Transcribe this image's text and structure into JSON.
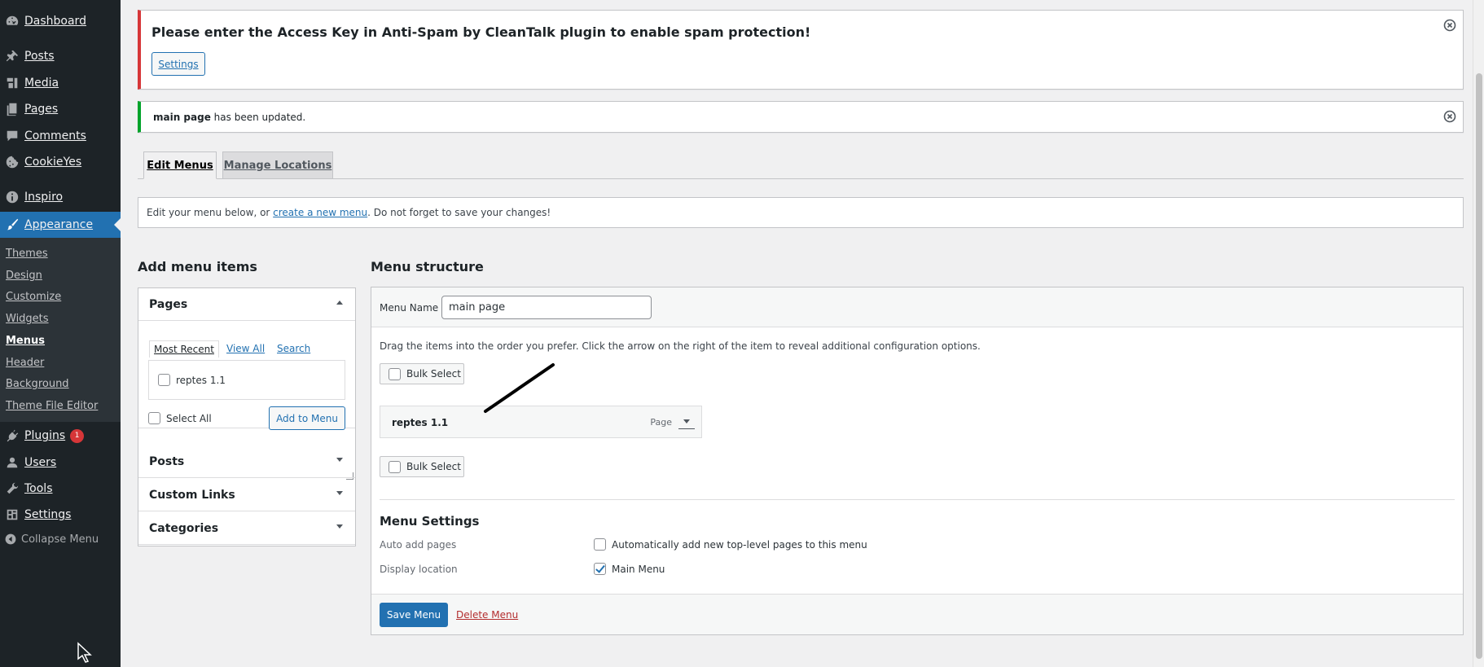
{
  "sidebar": {
    "items": [
      {
        "label": "Dashboard",
        "icon": "dashboard-icon"
      },
      {
        "label": "Posts",
        "icon": "pin-icon"
      },
      {
        "label": "Media",
        "icon": "media-icon"
      },
      {
        "label": "Pages",
        "icon": "pages-icon"
      },
      {
        "label": "Comments",
        "icon": "comment-icon"
      },
      {
        "label": "CookieYes",
        "icon": "cookie-icon"
      },
      {
        "label": "Inspiro",
        "icon": "info-icon"
      },
      {
        "label": "Appearance",
        "icon": "brush-icon"
      },
      {
        "label": "Plugins",
        "icon": "plug-icon",
        "badge": "1"
      },
      {
        "label": "Users",
        "icon": "user-icon"
      },
      {
        "label": "Tools",
        "icon": "wrench-icon"
      },
      {
        "label": "Settings",
        "icon": "settings-icon"
      }
    ],
    "submenu": [
      "Themes",
      "Design",
      "Customize",
      "Widgets",
      "Menus",
      "Header",
      "Background",
      "Theme File Editor"
    ],
    "collapse_label": "Collapse Menu",
    "accent": "#2271b1"
  },
  "notices": {
    "error_text": "Please enter the Access Key in Anti-Spam by CleanTalk plugin to enable spam protection!",
    "settings_button": "Settings",
    "success_bold": "main page",
    "success_rest": " has been updated."
  },
  "tabs": {
    "edit": "Edit Menus",
    "manage": "Manage Locations"
  },
  "manage": {
    "prefix": "Edit your menu below, or ",
    "link": "create a new menu",
    "suffix": ". Do not forget to save your changes!"
  },
  "left": {
    "heading": "Add menu items",
    "pages_title": "Pages",
    "subtabs": [
      "Most Recent",
      "View All",
      "Search"
    ],
    "page_items": [
      "reptes 1.1"
    ],
    "select_all": "Select All",
    "add_button": "Add to Menu",
    "other_sections": [
      "Posts",
      "Custom Links",
      "Categories"
    ]
  },
  "right": {
    "heading": "Menu structure",
    "menu_name_label": "Menu Name",
    "menu_name_value": "main page",
    "hint": "Drag the items into the order you prefer. Click the arrow on the right of the item to reveal additional configuration options.",
    "bulk_select": "Bulk Select",
    "menu_item": {
      "title": "reptes 1.1",
      "type": "Page"
    },
    "settings_title": "Menu Settings",
    "auto_add_label": "Auto add pages",
    "auto_add_option": "Automatically add new top-level pages to this menu",
    "auto_add_checked": false,
    "display_label": "Display location",
    "display_option": "Main Menu",
    "display_checked": true,
    "save_button": "Save Menu",
    "delete_link": "Delete Menu"
  }
}
